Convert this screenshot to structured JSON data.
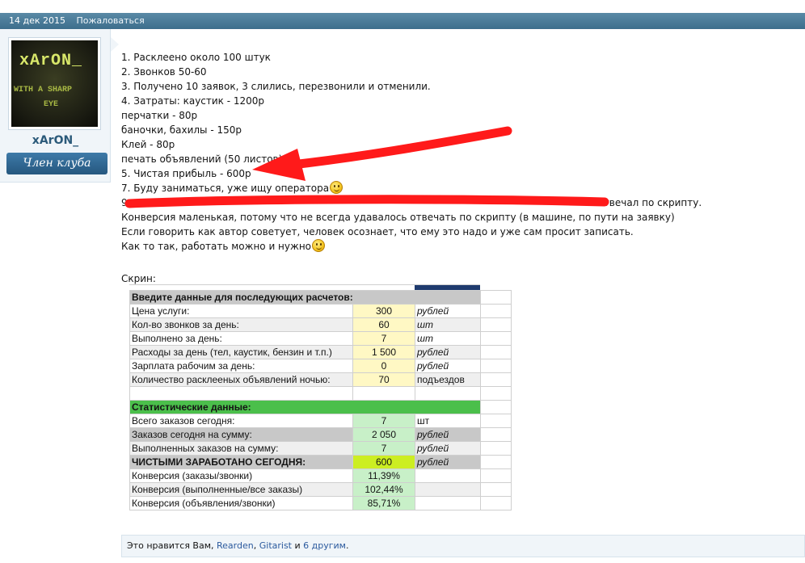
{
  "meta": {
    "date": "14 дек 2015",
    "report": "Пожаловаться"
  },
  "author": {
    "avatar_text": [
      "xArON_",
      "WITH A SHARP",
      "EYE"
    ],
    "username": "xArON_",
    "title": "Член клуба"
  },
  "post_lines": [
    "1. Расклеено около 100 штук",
    "2. Звонков 50-60",
    "3. Получено 10 заявок, 3 слились, перезвонили и отменили.",
    "4. Затраты: каустик - 1200р",
    "перчатки - 80р",
    "баночки, бахилы - 150р",
    "Клей - 80р",
    "печать объявлений (50 листов) - 4",
    "5. Чистая прибыль - 600р",
    "7. Буду заниматься, уже ищу оператора",
    "9.",
    "отвечал по скрипту.",
    "Конверсия маленькая, потому что не всегда удавалось отвечать по скрипту (в машине, по пути на заявку)",
    "Если говорить как автор советует, человек осознает, что ему это надо и уже сам просит записать.",
    "Как то так, работать можно и нужно"
  ],
  "screenshot_caption": "Скрин:",
  "table": {
    "input_header": "Введите данные для последующих расчетов:",
    "input_rows": [
      {
        "label": "Цена услуги:",
        "value": "300",
        "unit": "рублей"
      },
      {
        "label": "Кол-во звонков за день:",
        "value": "60",
        "unit": "шт"
      },
      {
        "label": "Выполнено за день:",
        "value": "7",
        "unit": "шт"
      },
      {
        "label": "Расходы за день (тел, каустик, бензин и т.п.)",
        "value": "1 500",
        "unit": "рублей"
      },
      {
        "label": "Зарплата рабочим за день:",
        "value": "0",
        "unit": "рублей"
      },
      {
        "label": "Количество расклееных объявлений ночью:",
        "value": "70",
        "unit": "подъездов"
      }
    ],
    "stats_header": "Статистические данные:",
    "stats_rows": [
      {
        "label": "Всего заказов сегодня:",
        "value": "7",
        "unit": "шт"
      },
      {
        "label": "Заказов сегодня на сумму:",
        "value": "2 050",
        "unit": "рублей"
      },
      {
        "label": "Выполненных заказов на сумму:",
        "value": "7",
        "unit": "рублей"
      },
      {
        "label": "ЧИСТЫМИ ЗАРАБОТАНО СЕГОДНЯ:",
        "value": "600",
        "unit": "рублей"
      },
      {
        "label": "Конверсия (заказы/звонки)",
        "value": "11,39%",
        "unit": ""
      },
      {
        "label": "Конверсия (выполненные/все заказы)",
        "value": "102,44%",
        "unit": ""
      },
      {
        "label": "Конверсия (объявления/звонки)",
        "value": "85,71%",
        "unit": ""
      }
    ]
  },
  "likes": {
    "prefix": "Это нравится Вам, ",
    "user1": "Rearden",
    "sep1": ", ",
    "user2": "Gitarist",
    "sep2": " и ",
    "others": "6 другим",
    "suffix": "."
  },
  "colors": {
    "annotation_red": "#ff1a1a",
    "header_bar": "#4a7d9b",
    "accent_link": "#2b5a9e"
  },
  "icons": [
    "smiley-icon"
  ]
}
